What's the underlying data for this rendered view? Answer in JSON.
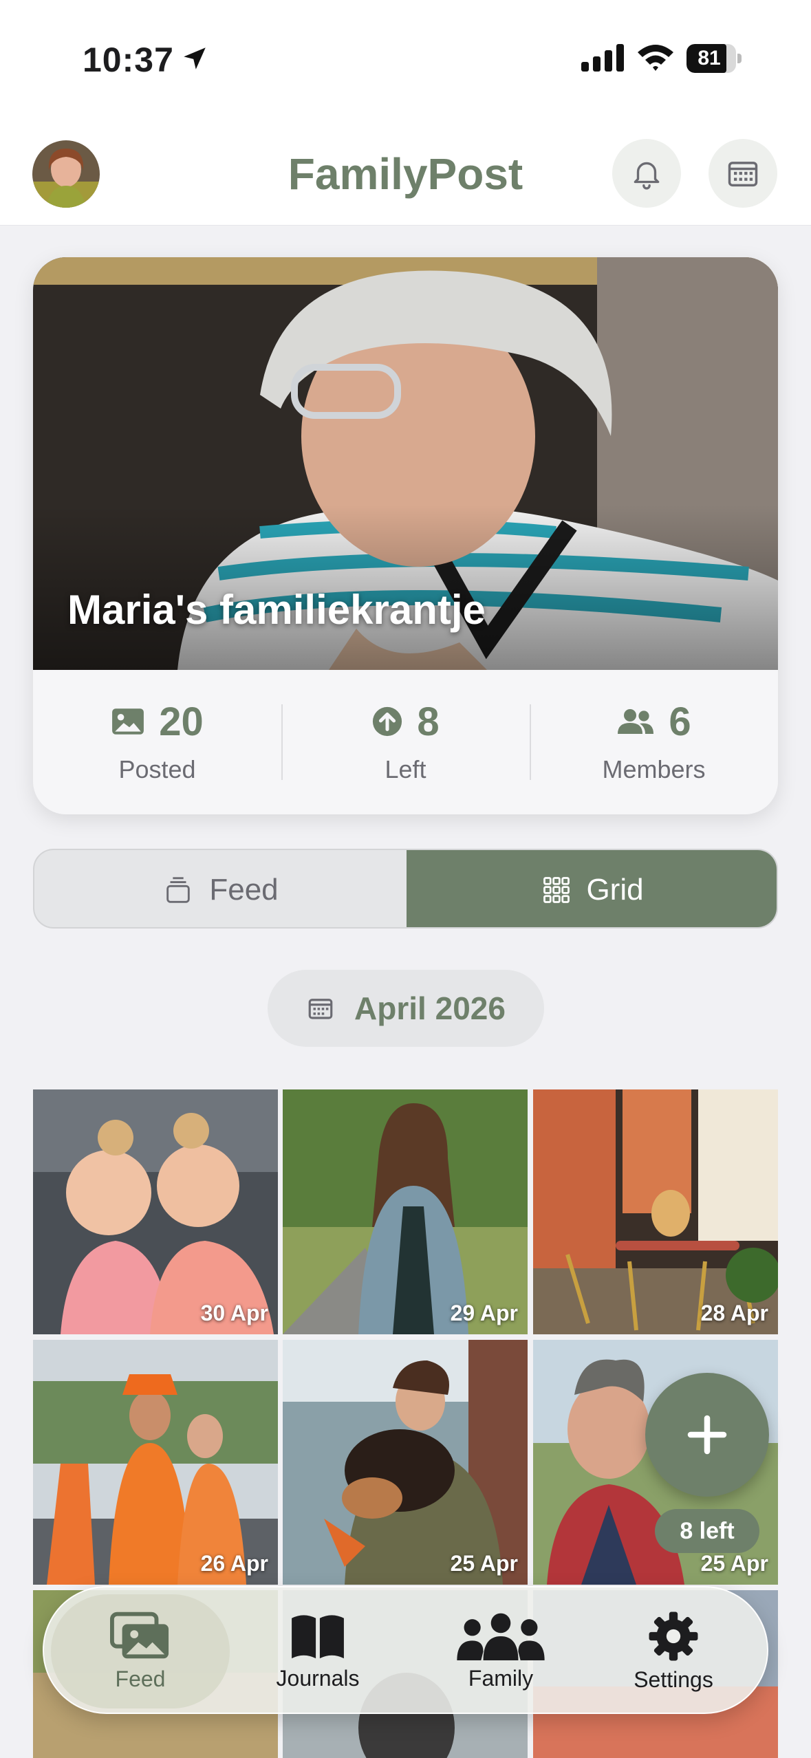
{
  "status": {
    "time": "10:37",
    "battery": "81",
    "battery_fraction": 0.81
  },
  "header": {
    "title": "FamilyPost",
    "avatar_alt": "profile"
  },
  "hero": {
    "title": "Maria's familiekrantje",
    "stats": [
      {
        "value": "20",
        "label": "Posted",
        "icon": "photo-icon"
      },
      {
        "value": "8",
        "label": "Left",
        "icon": "upload-arrow-icon"
      },
      {
        "value": "6",
        "label": "Members",
        "icon": "people-icon"
      }
    ]
  },
  "view_toggle": {
    "feed_label": "Feed",
    "grid_label": "Grid",
    "selected": "Grid"
  },
  "month": {
    "label": "April 2026"
  },
  "grid": {
    "tiles": [
      {
        "date": "30 Apr"
      },
      {
        "date": "29 Apr"
      },
      {
        "date": "28 Apr"
      },
      {
        "date": "26 Apr"
      },
      {
        "date": "25 Apr"
      },
      {
        "date": "25 Apr"
      }
    ]
  },
  "fab": {
    "icon": "plus-icon",
    "badge": "8 left"
  },
  "tabbar": {
    "items": [
      {
        "label": "Feed",
        "icon": "photos-icon",
        "active": true
      },
      {
        "label": "Journals",
        "icon": "book-icon",
        "active": false
      },
      {
        "label": "Family",
        "icon": "family-icon",
        "active": false
      },
      {
        "label": "Settings",
        "icon": "gear-icon",
        "active": false
      }
    ]
  },
  "colors": {
    "accent": "#6e806a",
    "background": "#f1f1f4",
    "muted_text": "#6b6b72"
  }
}
